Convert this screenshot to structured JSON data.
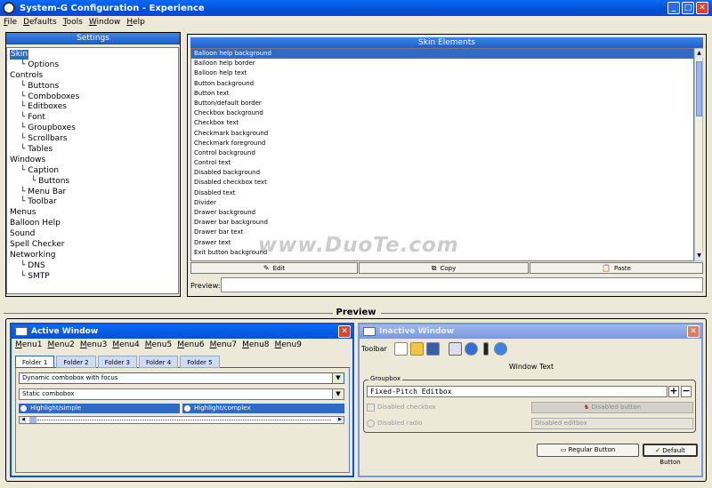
{
  "window": {
    "title": "System-G Configuration - Experience"
  },
  "menubar": [
    "File",
    "Defaults",
    "Tools",
    "Window",
    "Help"
  ],
  "settings": {
    "title": "Settings",
    "tree": [
      {
        "label": "Skin",
        "indent": 0,
        "selected": true
      },
      {
        "label": "Options",
        "indent": 1
      },
      {
        "label": "Controls",
        "indent": 0
      },
      {
        "label": "Buttons",
        "indent": 1
      },
      {
        "label": "Comboboxes",
        "indent": 1
      },
      {
        "label": "Editboxes",
        "indent": 1
      },
      {
        "label": "Font",
        "indent": 1
      },
      {
        "label": "Groupboxes",
        "indent": 1
      },
      {
        "label": "Scrollbars",
        "indent": 1
      },
      {
        "label": "Tables",
        "indent": 1
      },
      {
        "label": "Windows",
        "indent": 0
      },
      {
        "label": "Caption",
        "indent": 1
      },
      {
        "label": "Buttons",
        "indent": 2
      },
      {
        "label": "Menu Bar",
        "indent": 1
      },
      {
        "label": "Toolbar",
        "indent": 1
      },
      {
        "label": "Menus",
        "indent": 0
      },
      {
        "label": "Balloon Help",
        "indent": 0
      },
      {
        "label": "Sound",
        "indent": 0
      },
      {
        "label": "Spell Checker",
        "indent": 0
      },
      {
        "label": "Networking",
        "indent": 0
      },
      {
        "label": "DNS",
        "indent": 1
      },
      {
        "label": "SMTP",
        "indent": 1
      }
    ]
  },
  "skin_elements": {
    "title": "Skin Elements",
    "items": [
      "Balloon help background",
      "Balloon help border",
      "Balloon help text",
      "Button background",
      "Button text",
      "Button/default border",
      "Checkbox background",
      "Checkbox text",
      "Checkmark background",
      "Checkmark foreground",
      "Control background",
      "Control text",
      "Disabled background",
      "Disabled checkbox text",
      "Disabled text",
      "Divider",
      "Drawer background",
      "Drawer bar background",
      "Drawer bar text",
      "Drawer text",
      "Exit button background"
    ],
    "selected_index": 0,
    "edit_label": "Edit",
    "copy_label": "Copy",
    "paste_label": "Paste",
    "preview_label": "Preview:"
  },
  "preview": {
    "title": "Preview",
    "active": {
      "title": "Active Window",
      "menus": [
        "Menu1",
        "Menu2",
        "Menu3",
        "Menu4",
        "Menu5",
        "Menu6",
        "Menu7",
        "Menu8",
        "Menu9"
      ],
      "tabs": [
        "Folder 1",
        "Folder 2",
        "Folder 3",
        "Folder 4",
        "Folder 5"
      ],
      "combo1": "Dynamic combobox with focus",
      "combo2": "Static combobox",
      "radio1": "Highlight/simple",
      "radio2": "Highlight/complex"
    },
    "inactive": {
      "title": "Inactive Window",
      "toolbar_label": "Toolbar",
      "window_text": "Window Text",
      "groupbox_label": "Groupbox",
      "editbox_value": "Fixed-Pitch Editbox",
      "disabled_checkbox": "Disabled checkbox",
      "disabled_radio": "Disabled radio",
      "disabled_button": "Disabled button",
      "disabled_editbox": "Disabled editbox",
      "regular_button": "Regular Button",
      "default_button": "Default Button"
    }
  },
  "watermark": "www.DuoTe.com",
  "colors": {
    "selection": "#316AC5",
    "titlebar": "#0054E3",
    "inactive_title": "#7A96DF"
  }
}
